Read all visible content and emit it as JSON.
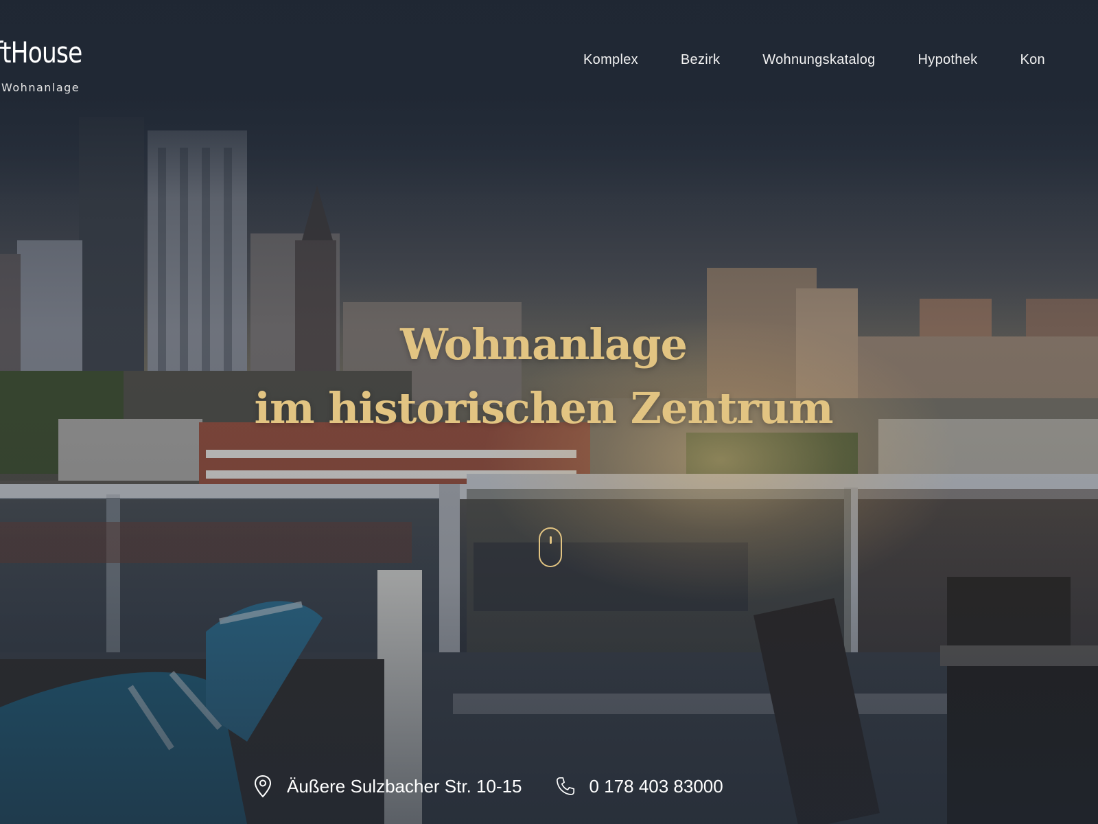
{
  "brand": {
    "name": "oftHouse",
    "subtitle": "Wohnanlage"
  },
  "nav": {
    "items": [
      "Komplex",
      "Bezirk",
      "Wohnungskatalog",
      "Hypothek",
      "Kon"
    ]
  },
  "hero": {
    "title_line1": "Wohnanlage",
    "title_line2": "im historischen Zentrum"
  },
  "contact": {
    "address": "Äußere Sulzbacher Str. 10-15",
    "phone": "0 178 403 83000",
    "icons": [
      "location-pin-icon",
      "phone-icon"
    ]
  },
  "colors": {
    "accent_gold": "#e2c482",
    "header_bg": "#1f2733",
    "text": "#ffffff"
  }
}
